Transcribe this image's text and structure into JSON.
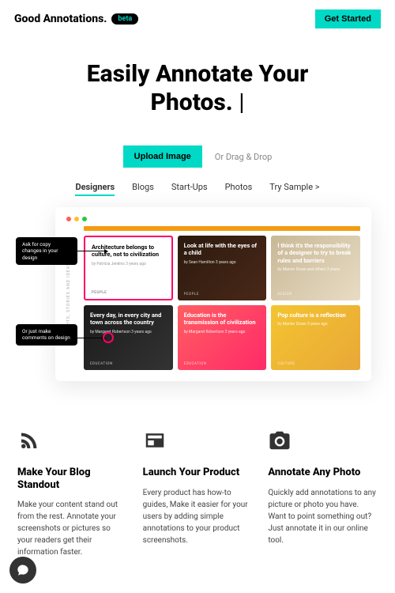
{
  "header": {
    "logo": "Good Annotations.",
    "badge": "beta",
    "cta": "Get Started"
  },
  "hero": {
    "title_line1": "Easily Annotate Your",
    "title_line2": "Photos.",
    "cursor": "|"
  },
  "upload": {
    "button": "Upload Image",
    "drag": "Or Drag & Drop"
  },
  "tabs": [
    "Designers",
    "Blogs",
    "Start-Ups",
    "Photos",
    "Try Sample >"
  ],
  "demo": {
    "sidebar": "THOUGHTS, STORIES AND IDEAS",
    "callout1": "Ask for copy changes in your design",
    "callout2": "Or just make comments on design",
    "cards": [
      {
        "title": "Architecture belongs to culture, not to civilization",
        "meta": "by Patricia Jenkins 3 years ago",
        "tag": "PEOPLE"
      },
      {
        "title": "Look at life with the eyes of a child",
        "meta": "by Sean Hamilton 3 years ago",
        "tag": "PEOPLE"
      },
      {
        "title": "I think it's the responsibility of a designer to try to break rules and barriers",
        "meta": "by Marion Duran and others 3 years",
        "tag": "DESIGN"
      },
      {
        "title": "Every day, in every city and town across the country",
        "meta": "by Margaret Robertson 3 years ago",
        "tag": "EDUCATION"
      },
      {
        "title": "Education is the transmission of civilization",
        "meta": "by Margaret Robertson 3 years ago",
        "tag": "EDUCATION"
      },
      {
        "title": "Pop culture is a reflection",
        "meta": "by Marion Duran 3 years ago",
        "tag": "CULTURE"
      }
    ]
  },
  "features": [
    {
      "title": "Make Your Blog Standout",
      "body": "Make your content stand out from the rest. Annotate your screenshots or pictures so your readers get their information faster."
    },
    {
      "title": "Launch Your Product",
      "body": "Every product has how-to guides, Make it easier for your users by adding simple annotations to your product screenshots."
    },
    {
      "title": "Annotate Any Photo",
      "body": "Quickly add annotations to any picture or photo you have. Want to point something out? Just annotate it in our online tool."
    }
  ]
}
